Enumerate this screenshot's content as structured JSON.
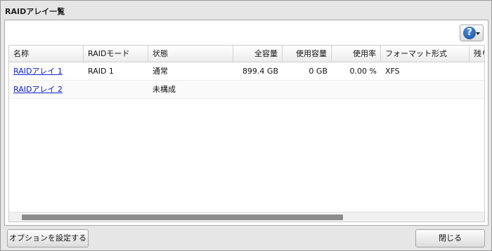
{
  "dialog": {
    "title": "RAIDアレイ一覧"
  },
  "help": {
    "icon": "help-icon",
    "glyph": "?"
  },
  "table": {
    "columns": [
      "名称",
      "RAIDモード",
      "状態",
      "全容量",
      "使用容量",
      "使用率",
      "フォーマット形式",
      "残り"
    ],
    "rows": [
      {
        "name": "RAIDアレイ 1",
        "mode": "RAID 1",
        "status": "通常",
        "total": "899.4 GB",
        "used": "0 GB",
        "usage": "0.00 %",
        "format": "XFS",
        "remaining": ""
      },
      {
        "name": "RAIDアレイ 2",
        "mode": "",
        "status": "未構成",
        "total": "",
        "used": "",
        "usage": "",
        "format": "",
        "remaining": ""
      }
    ]
  },
  "footer": {
    "options_label": "オプションを設定する",
    "close_label": "閉じる"
  }
}
